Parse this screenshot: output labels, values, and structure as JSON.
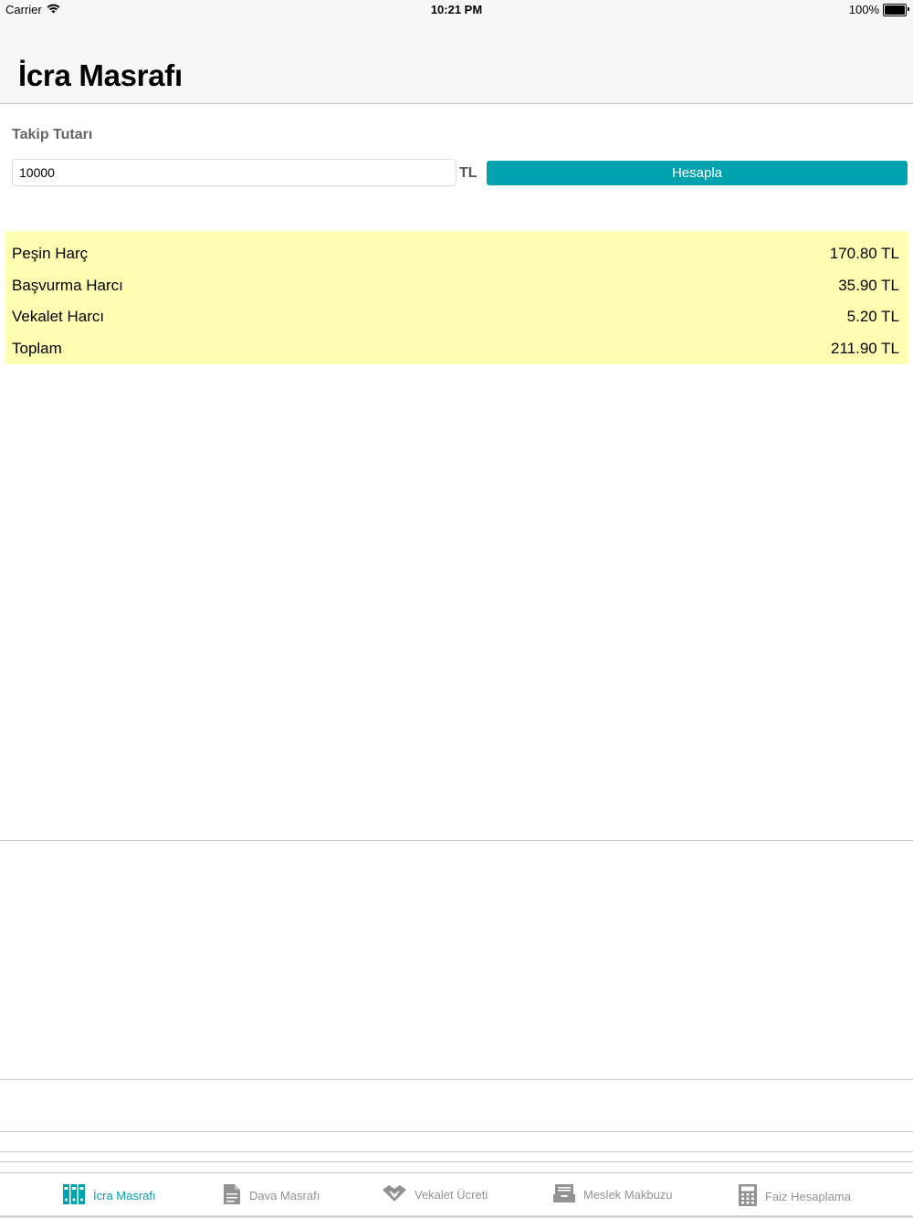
{
  "status_bar": {
    "carrier": "Carrier",
    "time": "10:21 PM",
    "battery": "100%"
  },
  "nav": {
    "title": "İcra Masrafı"
  },
  "form": {
    "label": "Takip Tutarı",
    "amount_value": "10000",
    "currency": "TL",
    "button_label": "Hesapla"
  },
  "results": {
    "rows": [
      {
        "label": "Peşin Harç",
        "value": "170.80 TL"
      },
      {
        "label": "Başvurma Harcı",
        "value": "35.90 TL"
      },
      {
        "label": "Vekalet Harcı",
        "value": "5.20 TL"
      },
      {
        "label": "Toplam",
        "value": "211.90 TL"
      }
    ]
  },
  "tabs": [
    {
      "label": "İcra Masrafı",
      "icon": "binders-icon",
      "active": true
    },
    {
      "label": "Dava Masrafı",
      "icon": "document-icon",
      "active": false
    },
    {
      "label": "Vekalet Ücreti",
      "icon": "handshake-icon",
      "active": false
    },
    {
      "label": "Meslek Makbuzu",
      "icon": "inbox-tray-icon",
      "active": false
    },
    {
      "label": "Faiz Hesaplama",
      "icon": "calculator-icon",
      "active": false
    }
  ],
  "colors": {
    "accent": "#00a3ad",
    "results_bg": "#fefeb3",
    "inactive_tab": "#929292"
  }
}
